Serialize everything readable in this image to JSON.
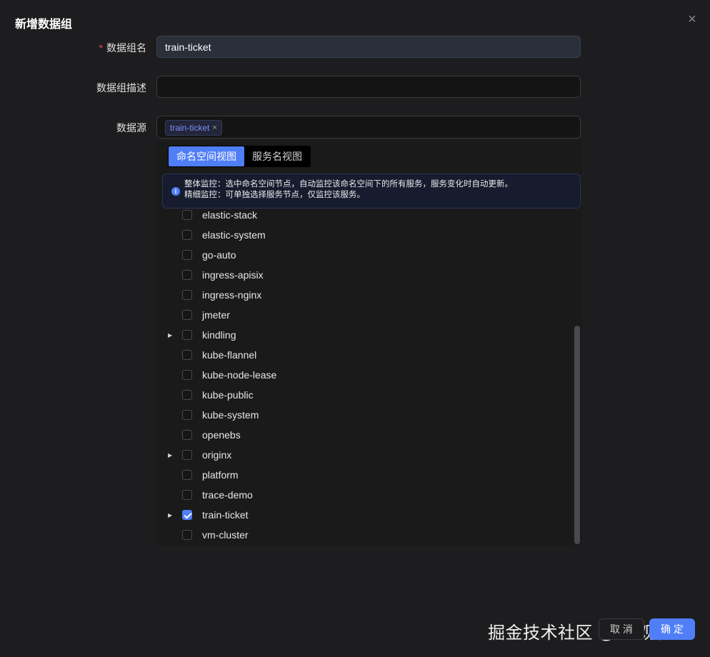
{
  "modal": {
    "title": "新增数据组",
    "close_icon": "×"
  },
  "form": {
    "name_label": "数据组名",
    "required_mark": "*",
    "name_value": "train-ticket",
    "desc_label": "数据组描述",
    "desc_value": "",
    "source_label": "数据源",
    "selected_tags": [
      {
        "label": "train-ticket",
        "remove_icon": "×"
      }
    ]
  },
  "dropdown": {
    "tabs": [
      {
        "label": "命名空间视图",
        "active": true
      },
      {
        "label": "服务名视图",
        "active": false
      }
    ],
    "info_icon": "i",
    "info_lines": [
      "整体监控：选中命名空间节点，自动监控该命名空间下的所有服务，服务变化时自动更新。",
      "精细监控：可单独选择服务节点，仅监控该服务。"
    ],
    "tree": [
      {
        "label": "elastic-stack",
        "checked": false,
        "expandable": false
      },
      {
        "label": "elastic-system",
        "checked": false,
        "expandable": false
      },
      {
        "label": "go-auto",
        "checked": false,
        "expandable": false
      },
      {
        "label": "ingress-apisix",
        "checked": false,
        "expandable": false
      },
      {
        "label": "ingress-nginx",
        "checked": false,
        "expandable": false
      },
      {
        "label": "jmeter",
        "checked": false,
        "expandable": false
      },
      {
        "label": "kindling",
        "checked": false,
        "expandable": true
      },
      {
        "label": "kube-flannel",
        "checked": false,
        "expandable": false
      },
      {
        "label": "kube-node-lease",
        "checked": false,
        "expandable": false
      },
      {
        "label": "kube-public",
        "checked": false,
        "expandable": false
      },
      {
        "label": "kube-system",
        "checked": false,
        "expandable": false
      },
      {
        "label": "openebs",
        "checked": false,
        "expandable": false
      },
      {
        "label": "originx",
        "checked": false,
        "expandable": true
      },
      {
        "label": "platform",
        "checked": false,
        "expandable": false
      },
      {
        "label": "trace-demo",
        "checked": false,
        "expandable": false
      },
      {
        "label": "train-ticket",
        "checked": true,
        "expandable": true
      },
      {
        "label": "vm-cluster",
        "checked": false,
        "expandable": false
      }
    ],
    "caret_icon": "▶"
  },
  "footer": {
    "cancel_label": "取 消",
    "ok_label": "确 定"
  },
  "watermark": "掘金技术社区 @ 云观秋毫",
  "colors": {
    "accent": "#4f7ef7",
    "background": "#1d1d1f",
    "required": "#e5484d"
  }
}
